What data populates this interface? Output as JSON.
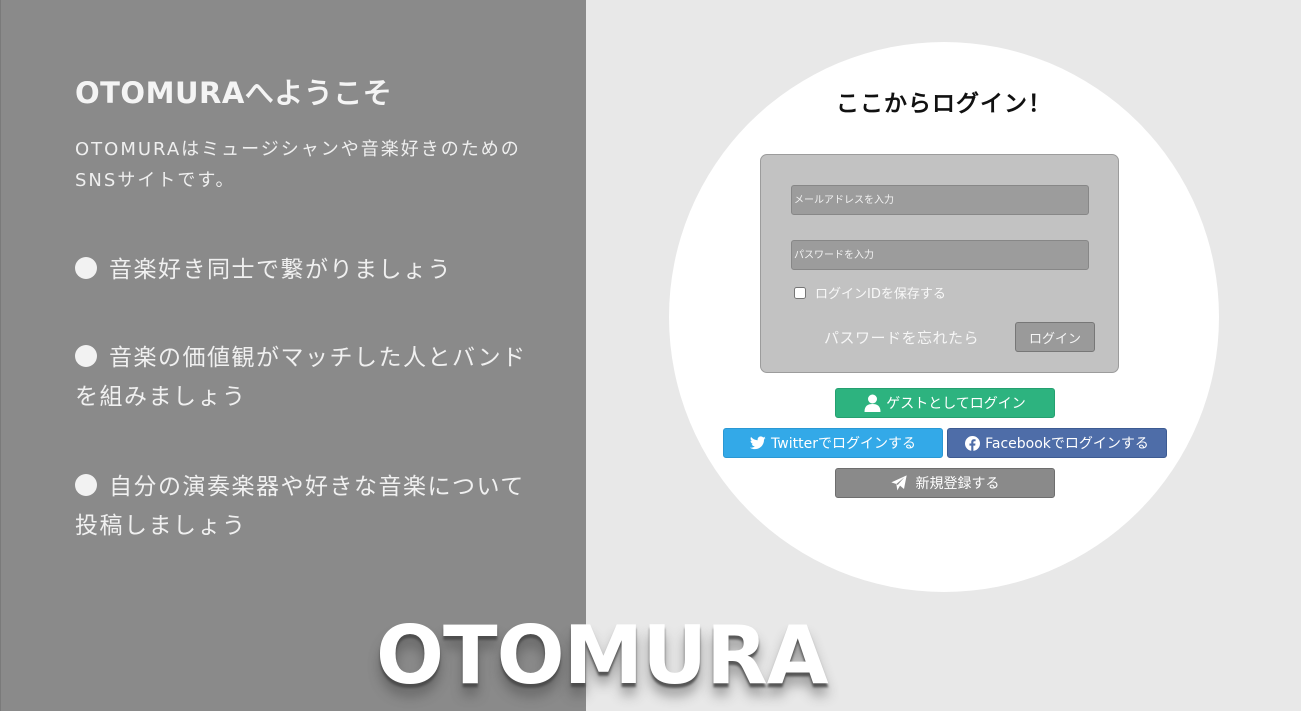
{
  "left_panel": {
    "title": "OTOMURAへようこそ",
    "description": "OTOMURAはミュージシャンや音楽好きのためのSNSサイトです。",
    "features": [
      "音楽好き同士で繋がりましょう",
      "音楽の価値観がマッチした人とバンドを組みましょう",
      "自分の演奏楽器や好きな音楽について投稿しましょう"
    ]
  },
  "brand": {
    "logo_text": "OTOMURA"
  },
  "login": {
    "heading": "ここからログイン！",
    "email_placeholder": "メールアドレスを入力",
    "email_value": "",
    "password_placeholder": "パスワードを入力",
    "password_value": "",
    "remember_label": "ログインIDを保存する",
    "remember_checked": false,
    "forgot_label": "パスワードを忘れたら",
    "submit_label": "ログイン"
  },
  "alt_logins": {
    "guest_label": "ゲストとしてログイン",
    "guest_icon": "user-icon",
    "twitter_label": "Twitterでログインする",
    "twitter_icon": "twitter-icon",
    "facebook_label": "Facebookでログインする",
    "facebook_icon": "facebook-icon",
    "register_label": "新規登録する",
    "register_icon": "paper-plane-icon"
  },
  "colors": {
    "left_panel_bg": "#8a8a8a",
    "page_bg": "#e8e8e8",
    "guest": "#2db37f",
    "twitter": "#33a9e8",
    "facebook": "#4e6da8",
    "register": "#8a8a8a"
  }
}
